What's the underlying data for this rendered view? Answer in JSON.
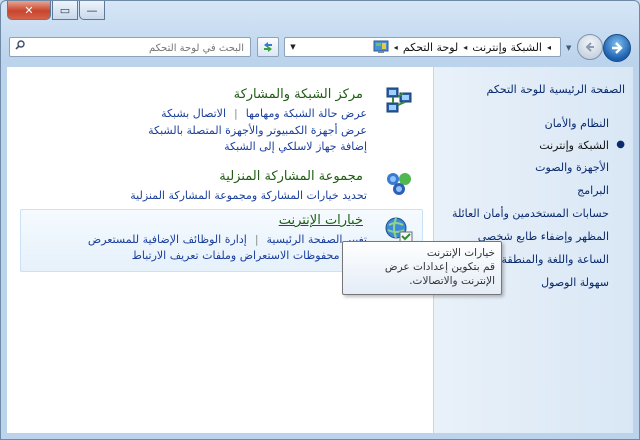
{
  "window": {
    "close_glyph": "✕",
    "max_glyph": "▭",
    "min_glyph": "—"
  },
  "nav": {
    "search_placeholder": "البحث في لوحة التحكم",
    "breadcrumb": [
      "لوحة التحكم",
      "الشبكة وإنترنت"
    ],
    "separator_glyph": "◂",
    "dropdown_glyph": "▼"
  },
  "sidebar": {
    "home": "الصفحة الرئيسية للوحة التحكم",
    "items": [
      {
        "label": "النظام والأمان",
        "current": false
      },
      {
        "label": "الشبكة وإنترنت",
        "current": true
      },
      {
        "label": "الأجهزة والصوت",
        "current": false
      },
      {
        "label": "البرامج",
        "current": false
      },
      {
        "label": "حسابات المستخدمين وأمان العائلة",
        "current": false
      },
      {
        "label": "المظهر وإضفاء طابع شخصي",
        "current": false
      },
      {
        "label": "الساعة واللغة والمنطقة",
        "current": false
      },
      {
        "label": "سهولة الوصول",
        "current": false
      }
    ]
  },
  "categories": [
    {
      "title": "مركز الشبكة والمشاركة",
      "rows": [
        [
          "عرض حالة الشبكة ومهامها",
          "الاتصال بشبكة"
        ],
        [
          "عرض أجهزة الكمبيوتر والأجهزة المتصلة بالشبكة"
        ],
        [
          "إضافة جهاز لاسلكي إلى الشبكة"
        ]
      ]
    },
    {
      "title": "مجموعة المشاركة المنزلية",
      "rows": [
        [
          "تحديد خيارات المشاركة ومجموعة المشاركة المنزلية"
        ]
      ]
    },
    {
      "title": "خيارات الإنترنت",
      "rows": [
        [
          "تغيير الصفحة الرئيسية",
          "إدارة الوظائف الإضافية للمستعرض"
        ],
        [
          "حذف محفوظات الاستعراض وملفات تعريف الارتباط"
        ]
      ]
    }
  ],
  "tooltip": {
    "title": "خيارات الإنترنت",
    "body": "قم بتكوين إعدادات عرض الإنترنت والاتصالات."
  }
}
